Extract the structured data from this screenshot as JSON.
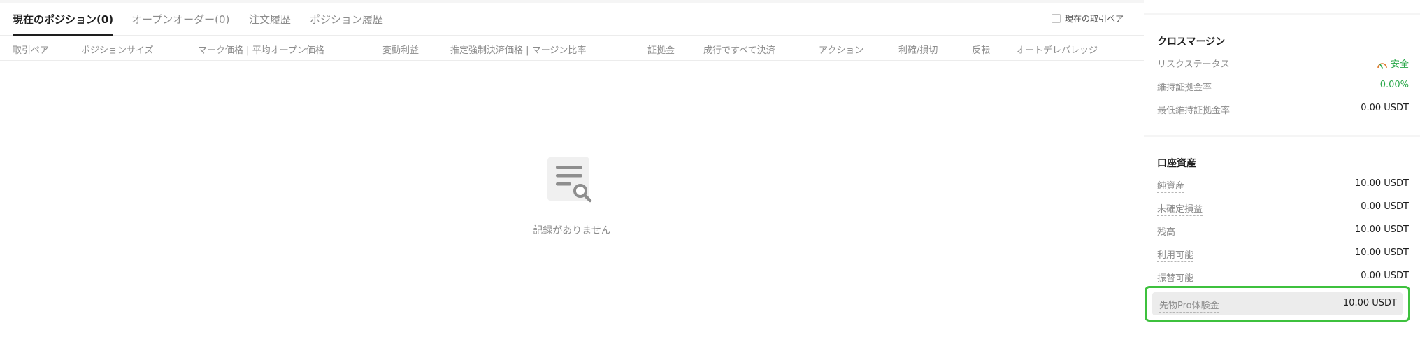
{
  "tabs": [
    {
      "label": "現在のポジション(0)",
      "active": true
    },
    {
      "label": "オープンオーダー(0)",
      "active": false
    },
    {
      "label": "注文履歴",
      "active": false
    },
    {
      "label": "ポジション履歴",
      "active": false
    }
  ],
  "current_pair_label": "現在の取引ペア",
  "columns": [
    {
      "label": "取引ペア",
      "dashed": false
    },
    {
      "label": "ポジションサイズ",
      "dashed": true
    },
    {
      "label": "マーク価格",
      "dashed": true
    },
    {
      "label": "平均オープン価格",
      "dashed": true
    },
    {
      "label": "変動利益",
      "dashed": true
    },
    {
      "label": "推定強制決済価格",
      "dashed": true
    },
    {
      "label": "マージン比率",
      "dashed": true
    },
    {
      "label": "証拠金",
      "dashed": true
    },
    {
      "label": "成行ですべて決済",
      "dashed": false
    },
    {
      "label": "アクション",
      "dashed": false
    },
    {
      "label": "利確/損切",
      "dashed": true
    },
    {
      "label": "反転",
      "dashed": true
    },
    {
      "label": "オートデレバレッジ",
      "dashed": true
    }
  ],
  "separator": "|",
  "empty_state": {
    "text": "記録がありません",
    "icon": "document-search-icon"
  },
  "cross_margin": {
    "title": "クロスマージン",
    "rows": [
      {
        "label": "リスクステータス",
        "value": "安全",
        "icon": "gauge-icon"
      },
      {
        "label": "維持証拠金率",
        "value": "0.00%"
      },
      {
        "label": "最低維持証拠金率",
        "value": "0.00 USDT"
      }
    ]
  },
  "account_assets": {
    "title": "口座資産",
    "rows": [
      {
        "label": "純資産",
        "value": "10.00 USDT"
      },
      {
        "label": "未確定損益",
        "value": "0.00 USDT"
      },
      {
        "label": "残高",
        "value": "10.00 USDT"
      },
      {
        "label": "利用可能",
        "value": "10.00 USDT"
      },
      {
        "label": "振替可能",
        "value": "0.00 USDT"
      }
    ],
    "highlight": {
      "label": "先物Pro体験金",
      "value": "10.00 USDT"
    }
  },
  "colors": {
    "accent_green": "#2aa84a",
    "highlight_border": "#3ec13e"
  }
}
